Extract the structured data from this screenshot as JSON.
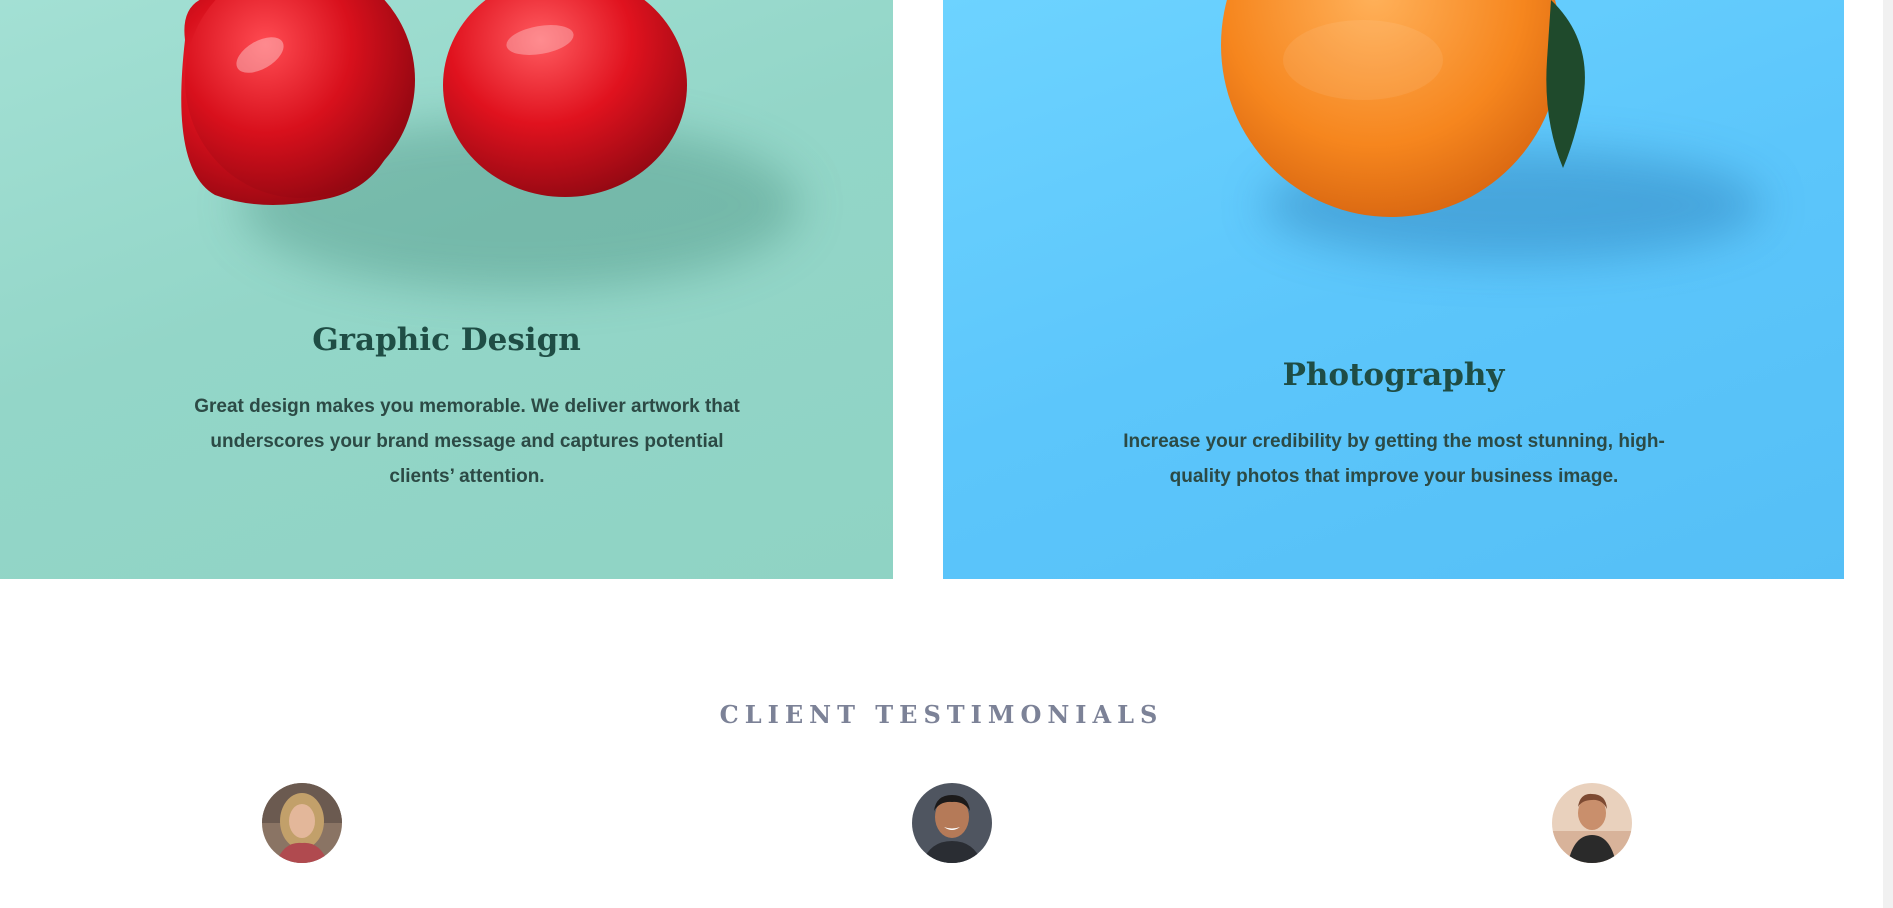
{
  "services": [
    {
      "title": "Graphic Design",
      "description": "Great design makes you memorable. We deliver artwork that underscores your brand message and captures potential clients’ attention.",
      "image": "cherries-icon",
      "background": "#93d6c8"
    },
    {
      "title": "Photography",
      "description": "Increase your credibility by getting the most stunning, high-quality photos that improve your business image.",
      "image": "orange-icon",
      "background": "#5cc6fb"
    }
  ],
  "testimonials": {
    "heading": "CLIENT TESTIMONIALS",
    "avatars": [
      "woman-long-hair-avatar",
      "smiling-man-avatar",
      "woman-beach-avatar"
    ]
  },
  "colors": {
    "heading_text": "#1f4d45",
    "body_text": "#2c4a45",
    "section_heading": "#7c8297"
  }
}
